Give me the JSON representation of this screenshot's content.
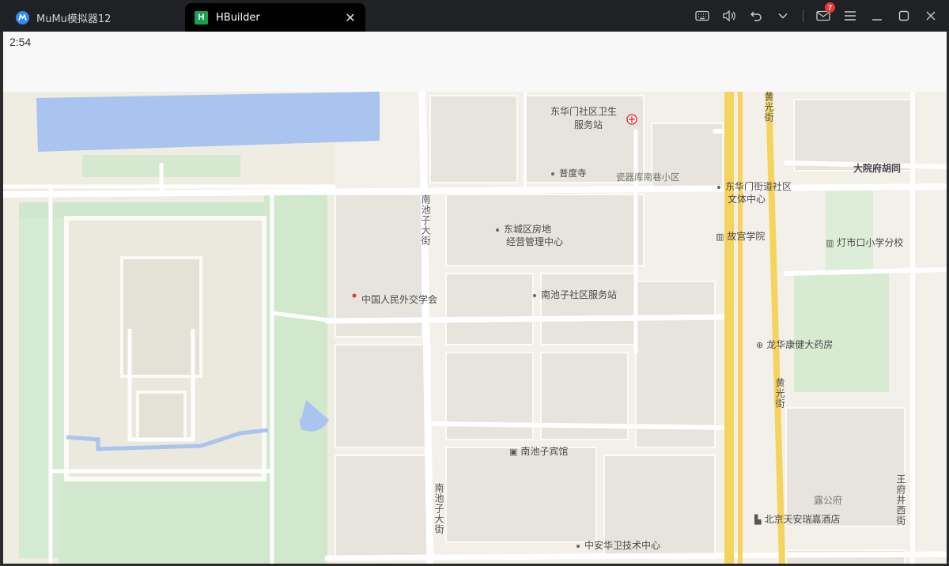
{
  "titlebar": {
    "tabs": [
      {
        "label": "MuMu模拟器12",
        "active": false
      },
      {
        "label": "HBuilder",
        "active": true
      }
    ],
    "mail_badge": "7"
  },
  "status": {
    "time": "2:54"
  },
  "map": {
    "labels": {
      "donghuamen_clinic_1": "东华门社区卫生",
      "donghuamen_clinic_2": "服务站",
      "pudu_temple": "普度寺",
      "ciqiku_community": "瓷器库南巷小区",
      "dongcheng_housing_1": "东城区房地",
      "dongcheng_housing_2": "经营管理中心",
      "nanchizi_avenue_north": "南池子大街",
      "donghuamen_street_1": "东华门街道社区",
      "donghuamen_street_2": "文体中心",
      "dayuanfu_hutong": "大院府胡同",
      "palace_college": "故宫学院",
      "dengshikou_school": "灯市口小学分校",
      "diplomacy_society": "中国人民外交学会",
      "nanchizi_service": "南池子社区服务站",
      "longhua_pharmacy": "龙华康健大药房",
      "nanchizi_hotel": "南池子宾馆",
      "nanchizi_avenue_south": "南池子大街",
      "huangguang_street": "黄光街",
      "huangguang_street_top": "黄光街",
      "wangfujing_west": "王府井西街",
      "lugong_mansion": "露公府",
      "tianan_hotel": "北京天安瑞嘉酒店",
      "zhongan_center": "中安华卫技术中心"
    }
  }
}
